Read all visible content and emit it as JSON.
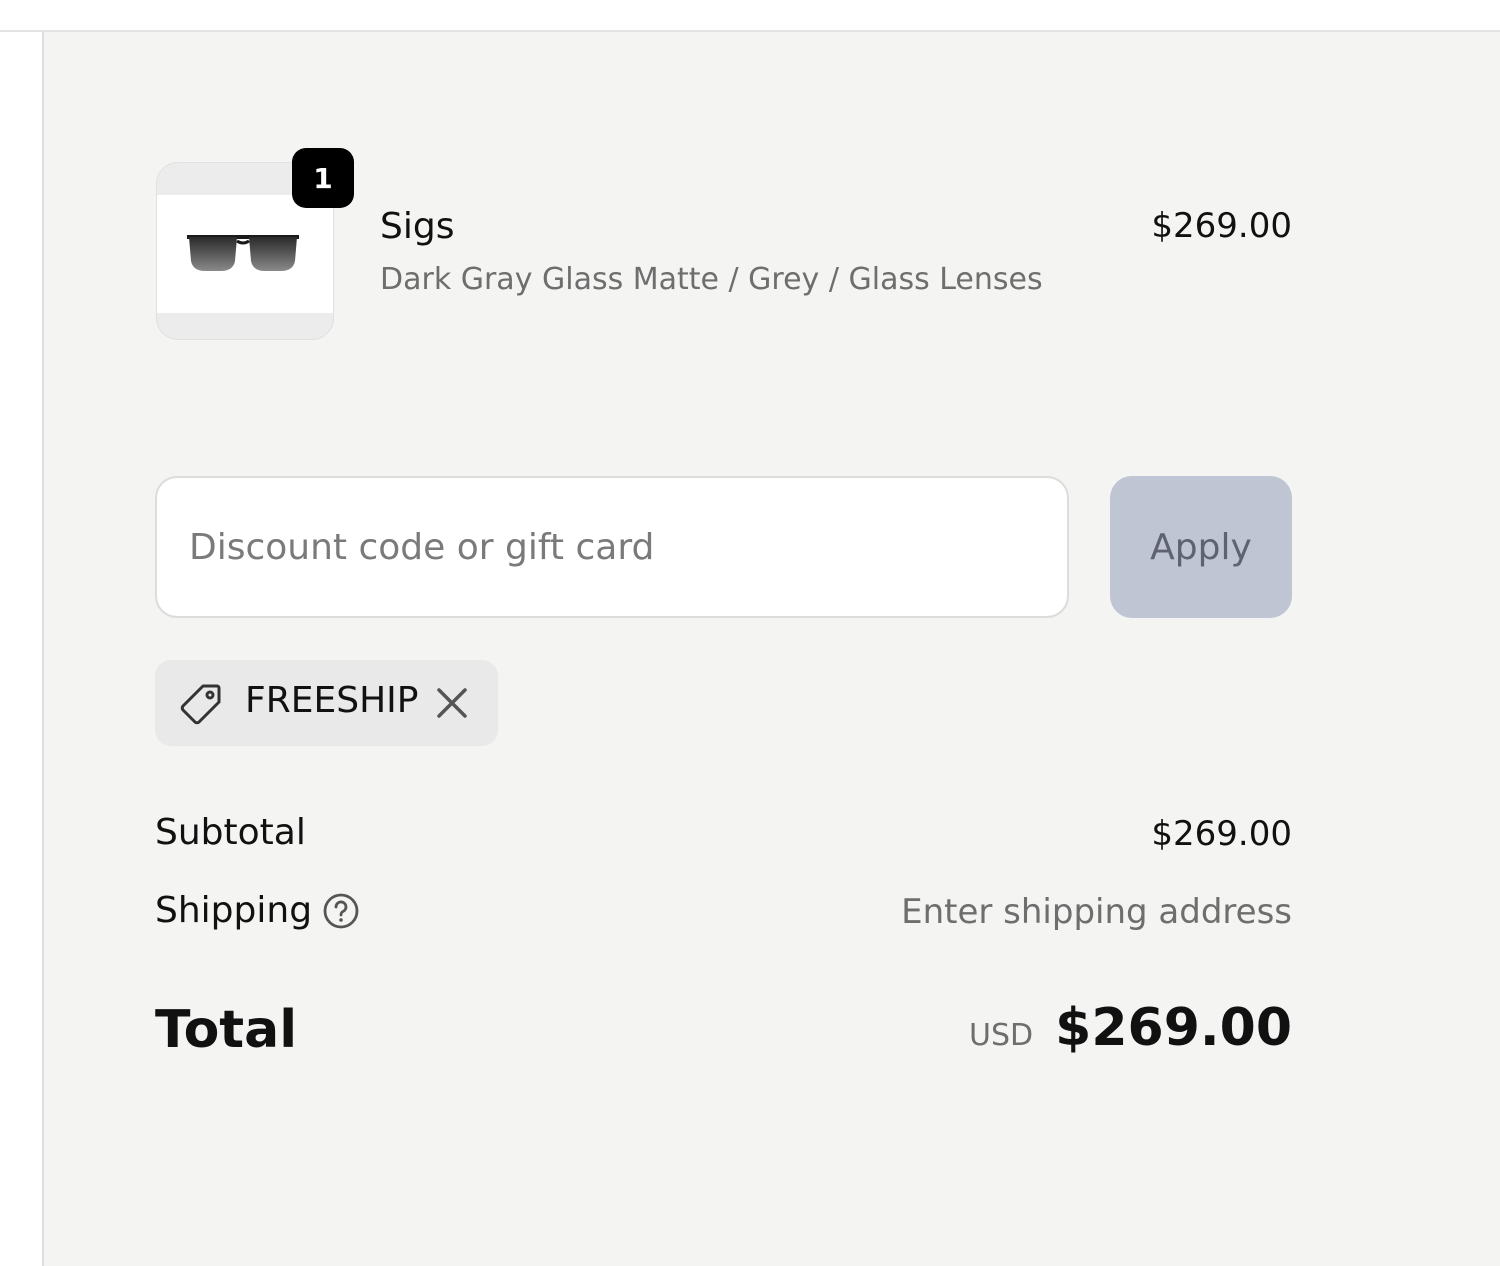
{
  "cart": {
    "item": {
      "quantity": "1",
      "name": "Sigs",
      "variant": "Dark Gray Glass Matte / Grey / Glass Lenses",
      "price": "$269.00",
      "thumbnail_icon": "sunglasses-icon"
    }
  },
  "discount": {
    "placeholder": "Discount code or gift card",
    "value": "",
    "apply_label": "Apply",
    "applied_code": "FREESHIP",
    "applied_icon": "tag-icon",
    "remove_icon": "close-icon"
  },
  "totals": {
    "subtotal_label": "Subtotal",
    "subtotal_value": "$269.00",
    "shipping_label": "Shipping",
    "shipping_help_icon": "question-circle-icon",
    "shipping_value": "Enter shipping address",
    "total_label": "Total",
    "currency": "USD",
    "total_value": "$269.00"
  },
  "colors": {
    "panel_background": "#f4f4f3",
    "apply_button_disabled": "#c0c5d4",
    "badge": "#000000"
  }
}
